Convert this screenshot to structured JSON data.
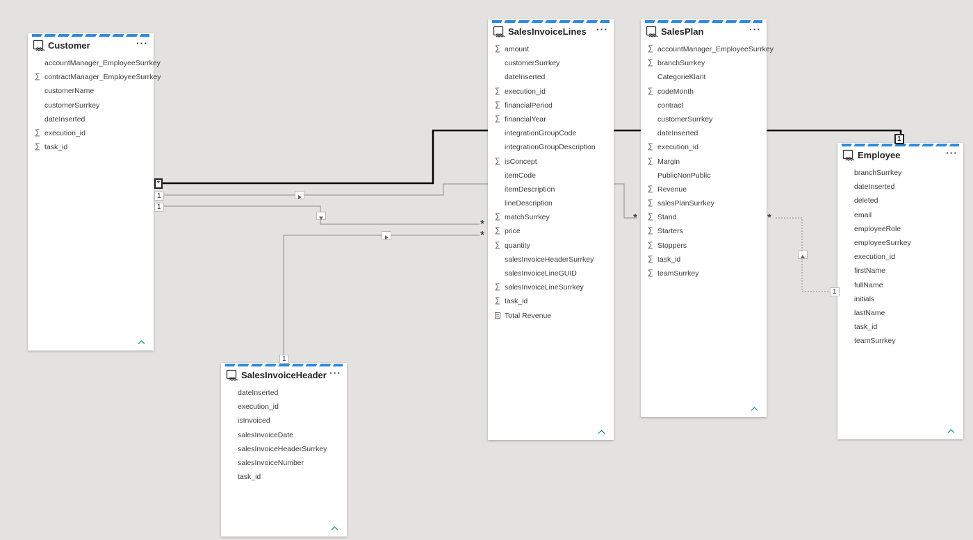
{
  "tables": [
    {
      "id": "customer",
      "name": "Customer",
      "fields": [
        {
          "name": "accountManager_EmployeeSurrkey",
          "type": "text"
        },
        {
          "name": "contractManager_EmployeeSurrkey",
          "type": "sum"
        },
        {
          "name": "customerName",
          "type": "text"
        },
        {
          "name": "customerSurrkey",
          "type": "text"
        },
        {
          "name": "dateInserted",
          "type": "text"
        },
        {
          "name": "execution_id",
          "type": "sum"
        },
        {
          "name": "task_id",
          "type": "sum"
        }
      ]
    },
    {
      "id": "salesinvoicelines",
      "name": "SalesInvoiceLines",
      "fields": [
        {
          "name": "amount",
          "type": "sum"
        },
        {
          "name": "customerSurrkey",
          "type": "text"
        },
        {
          "name": "dateInserted",
          "type": "text"
        },
        {
          "name": "execution_id",
          "type": "sum"
        },
        {
          "name": "financialPeriod",
          "type": "sum"
        },
        {
          "name": "financialYear",
          "type": "sum"
        },
        {
          "name": "integrationGroupCode",
          "type": "text"
        },
        {
          "name": "integrationGroupDescription",
          "type": "text"
        },
        {
          "name": "isConcept",
          "type": "sum"
        },
        {
          "name": "itemCode",
          "type": "text"
        },
        {
          "name": "itemDescription",
          "type": "text"
        },
        {
          "name": "lineDescription",
          "type": "text"
        },
        {
          "name": "matchSurrkey",
          "type": "sum"
        },
        {
          "name": "price",
          "type": "sum"
        },
        {
          "name": "quantity",
          "type": "sum"
        },
        {
          "name": "salesInvoiceHeaderSurrkey",
          "type": "text"
        },
        {
          "name": "salesInvoiceLineGUID",
          "type": "text"
        },
        {
          "name": "salesInvoiceLineSurrkey",
          "type": "sum"
        },
        {
          "name": "task_id",
          "type": "sum"
        },
        {
          "name": "Total Revenue",
          "type": "calc"
        }
      ]
    },
    {
      "id": "salesplan",
      "name": "SalesPlan",
      "fields": [
        {
          "name": "accountManager_EmployeeSurrkey",
          "type": "sum"
        },
        {
          "name": "branchSurrkey",
          "type": "sum"
        },
        {
          "name": "CategorieKlant",
          "type": "text"
        },
        {
          "name": "codeMonth",
          "type": "sum"
        },
        {
          "name": "contract",
          "type": "text"
        },
        {
          "name": "customerSurrkey",
          "type": "text"
        },
        {
          "name": "dateInserted",
          "type": "text"
        },
        {
          "name": "execution_id",
          "type": "sum"
        },
        {
          "name": "Margin",
          "type": "sum"
        },
        {
          "name": "PublicNonPublic",
          "type": "text"
        },
        {
          "name": "Revenue",
          "type": "sum"
        },
        {
          "name": "salesPlanSurrkey",
          "type": "sum"
        },
        {
          "name": "Stand",
          "type": "sum"
        },
        {
          "name": "Starters",
          "type": "sum"
        },
        {
          "name": "Stoppers",
          "type": "sum"
        },
        {
          "name": "task_id",
          "type": "sum"
        },
        {
          "name": "teamSurrkey",
          "type": "sum"
        }
      ]
    },
    {
      "id": "employee",
      "name": "Employee",
      "fields": [
        {
          "name": "branchSurrkey",
          "type": "text"
        },
        {
          "name": "dateInserted",
          "type": "text"
        },
        {
          "name": "deleted",
          "type": "text"
        },
        {
          "name": "email",
          "type": "text"
        },
        {
          "name": "employeeRole",
          "type": "text"
        },
        {
          "name": "employeeSurrkey",
          "type": "text"
        },
        {
          "name": "execution_id",
          "type": "text"
        },
        {
          "name": "firstName",
          "type": "text"
        },
        {
          "name": "fullName",
          "type": "text"
        },
        {
          "name": "initials",
          "type": "text"
        },
        {
          "name": "lastName",
          "type": "text"
        },
        {
          "name": "task_id",
          "type": "text"
        },
        {
          "name": "teamSurrkey",
          "type": "text"
        }
      ]
    },
    {
      "id": "salesinvoiceheader",
      "name": "SalesInvoiceHeader",
      "fields": [
        {
          "name": "dateInserted",
          "type": "text"
        },
        {
          "name": "execution_id",
          "type": "text"
        },
        {
          "name": "isInvoiced",
          "type": "text"
        },
        {
          "name": "salesInvoiceDate",
          "type": "text"
        },
        {
          "name": "salesInvoiceHeaderSurrkey",
          "type": "text"
        },
        {
          "name": "salesInvoiceNumber",
          "type": "text"
        },
        {
          "name": "task_id",
          "type": "text"
        }
      ]
    }
  ],
  "cardinality": {
    "one": "1",
    "many": "*"
  },
  "ui": {
    "more_label": "···"
  },
  "colors": {
    "accent": "#2f8ae0",
    "canvas": "#e3e2e0",
    "line": "#8a8a8a",
    "active_line": "#000000"
  }
}
